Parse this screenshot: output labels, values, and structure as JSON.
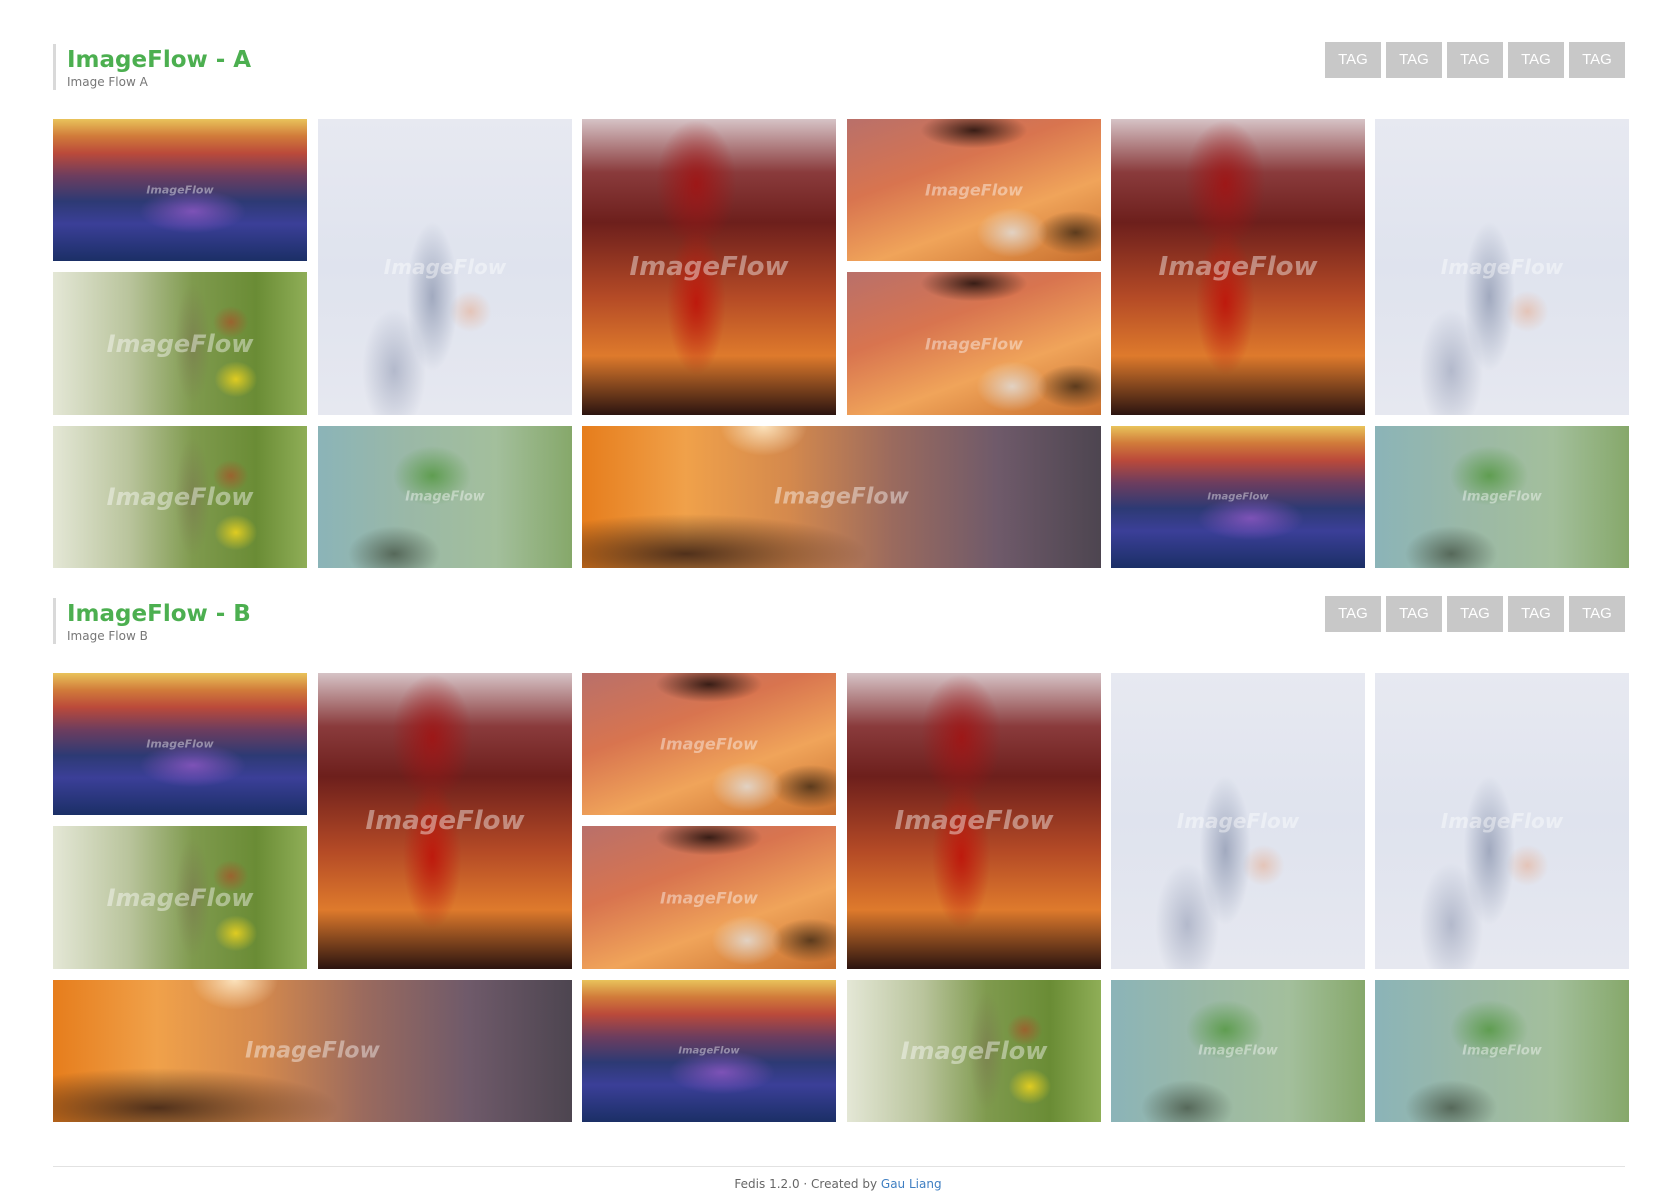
{
  "sections": [
    {
      "title": "ImageFlow - A",
      "subtitle": "Image Flow A",
      "tags": [
        "TAG",
        "TAG",
        "TAG",
        "TAG",
        "TAG"
      ],
      "tiles": [
        {
          "photo": "p-ocean",
          "watermark": "ImageFlow"
        },
        {
          "photo": "p-white",
          "watermark": "ImageFlow"
        },
        {
          "photo": "p-red",
          "watermark": "ImageFlow"
        },
        {
          "photo": "p-orange",
          "watermark": "ImageFlow"
        },
        {
          "photo": "p-red",
          "watermark": "ImageFlow"
        },
        {
          "photo": "p-white",
          "watermark": "ImageFlow"
        },
        {
          "photo": "p-leaf",
          "watermark": "ImageFlow"
        },
        {
          "photo": "p-orange",
          "watermark": "ImageFlow"
        },
        {
          "photo": "p-leaf",
          "watermark": "ImageFlow"
        },
        {
          "photo": "p-teal",
          "watermark": "ImageFlow"
        },
        {
          "photo": "p-sunset",
          "watermark": "ImageFlow"
        },
        {
          "photo": "p-ocean",
          "watermark": "ImageFlow"
        },
        {
          "photo": "p-teal",
          "watermark": "ImageFlow"
        }
      ]
    },
    {
      "title": "ImageFlow - B",
      "subtitle": "Image Flow B",
      "tags": [
        "TAG",
        "TAG",
        "TAG",
        "TAG",
        "TAG"
      ],
      "tiles": [
        {
          "photo": "p-ocean",
          "watermark": "ImageFlow"
        },
        {
          "photo": "p-red",
          "watermark": "ImageFlow"
        },
        {
          "photo": "p-orange",
          "watermark": "ImageFlow"
        },
        {
          "photo": "p-red",
          "watermark": "ImageFlow"
        },
        {
          "photo": "p-white",
          "watermark": "ImageFlow"
        },
        {
          "photo": "p-white",
          "watermark": "ImageFlow"
        },
        {
          "photo": "p-leaf",
          "watermark": "ImageFlow"
        },
        {
          "photo": "p-orange",
          "watermark": "ImageFlow"
        },
        {
          "photo": "p-sunset",
          "watermark": "ImageFlow"
        },
        {
          "photo": "p-ocean",
          "watermark": "ImageFlow"
        },
        {
          "photo": "p-leaf",
          "watermark": "ImageFlow"
        },
        {
          "photo": "p-teal",
          "watermark": "ImageFlow"
        },
        {
          "photo": "p-teal",
          "watermark": "ImageFlow"
        }
      ]
    }
  ],
  "footer": {
    "text": "Fedis 1.2.0 · Created by ",
    "author": "Gau Liang"
  }
}
